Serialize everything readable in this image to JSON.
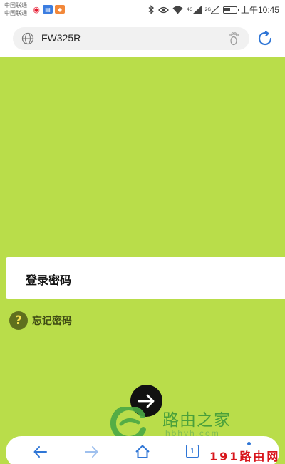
{
  "status_bar": {
    "carrier_1": "中国联通",
    "carrier_2": "中国联通",
    "signal_1": "4G",
    "signal_2": "2G",
    "time": "上午10:45",
    "battery_level": 0.5,
    "icons": [
      "weibo-icon",
      "news-icon",
      "taobao-icon",
      "bluetooth-icon",
      "eye-icon",
      "wifi-icon",
      "signal-icon",
      "battery-icon"
    ]
  },
  "browser": {
    "url": "FW325R",
    "icons": [
      "globe-icon",
      "footprint-icon",
      "refresh-icon"
    ]
  },
  "login": {
    "password_label": "登录密码",
    "forgot_label": "忘记密码",
    "forgot_icon": "?"
  },
  "toolbar": {
    "tab_count": "1",
    "icons": [
      "back-icon",
      "forward-icon",
      "home-icon",
      "tabs-icon",
      "menu-icon"
    ]
  },
  "watermark": {
    "brand_cn": "路由之家",
    "brand_url": "hbhyh.com",
    "brand_191": "191路由网"
  },
  "colors": {
    "page_bg": "#b9dd4a",
    "accent_blue": "#2f76d6",
    "question_icon_bg": "#5f6f1e",
    "watermark_red": "#d8161c"
  }
}
